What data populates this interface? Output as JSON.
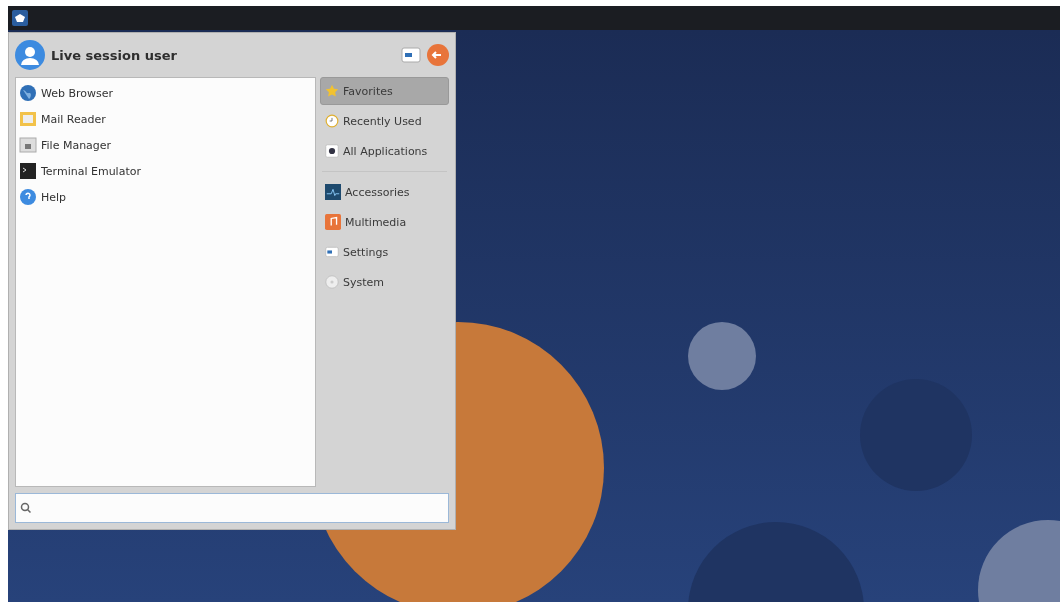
{
  "user": {
    "name": "Live session user"
  },
  "favorites": [
    {
      "label": "Web Browser"
    },
    {
      "label": "Mail Reader"
    },
    {
      "label": "File Manager"
    },
    {
      "label": "Terminal Emulator"
    },
    {
      "label": "Help"
    }
  ],
  "categories": [
    {
      "kind": "item",
      "label": "Favorites",
      "selected": true
    },
    {
      "kind": "item",
      "label": "Recently Used",
      "selected": false
    },
    {
      "kind": "item",
      "label": "All Applications",
      "selected": false
    },
    {
      "kind": "separator"
    },
    {
      "kind": "item",
      "label": "Accessories",
      "selected": false
    },
    {
      "kind": "item",
      "label": "Multimedia",
      "selected": false
    },
    {
      "kind": "item",
      "label": "Settings",
      "selected": false
    },
    {
      "kind": "item",
      "label": "System",
      "selected": false
    }
  ]
}
